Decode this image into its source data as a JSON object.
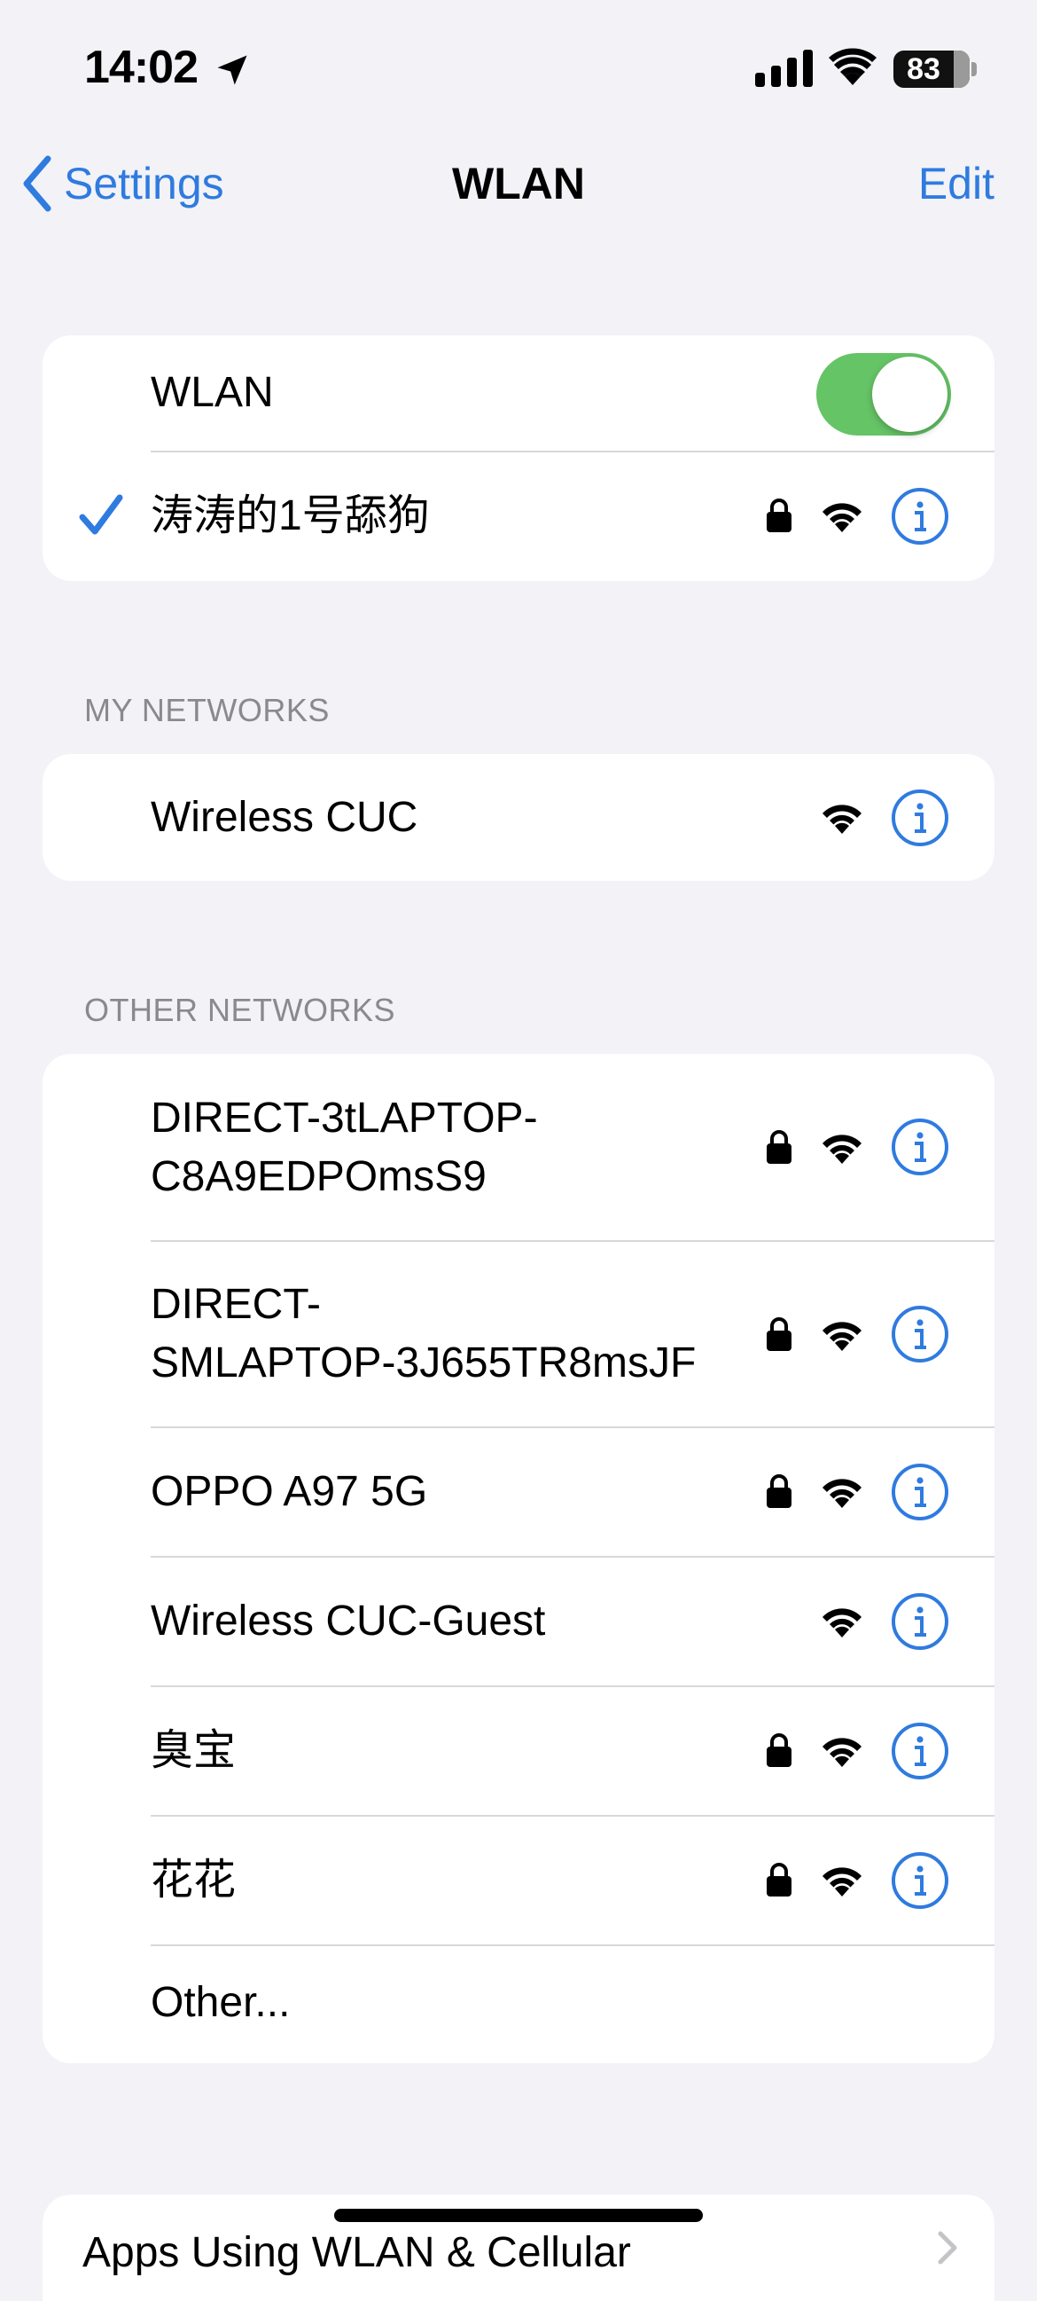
{
  "status_bar": {
    "time": "14:02",
    "battery": "83"
  },
  "nav": {
    "back_label": "Settings",
    "title": "WLAN",
    "edit_label": "Edit"
  },
  "wlan": {
    "label": "WLAN",
    "enabled": true,
    "connected_network": "涛涛的1号舔狗"
  },
  "sections": {
    "my_networks_header": "MY NETWORKS",
    "other_networks_header": "OTHER NETWORKS"
  },
  "my_networks": [
    {
      "name": "Wireless CUC",
      "locked": false
    }
  ],
  "other_networks": [
    {
      "name_line1": "DIRECT-3tLAPTOP-",
      "name_line2": "C8A9EDPOmsS9",
      "locked": true
    },
    {
      "name_line1": "DIRECT-",
      "name_line2": "SMLAPTOP-3J655TR8msJF",
      "locked": true
    },
    {
      "name": "OPPO A97 5G",
      "locked": true
    },
    {
      "name": "Wireless CUC-Guest",
      "locked": false
    },
    {
      "name": "臭宝",
      "locked": true
    },
    {
      "name": "花花",
      "locked": true
    }
  ],
  "other_label": "Other...",
  "bottom_row_label": "Apps Using WLAN & Cellular",
  "icons": [
    "location-arrow-icon",
    "cellular-signal-icon",
    "wifi-icon",
    "battery-icon",
    "back-chevron-icon",
    "checkmark-icon",
    "lock-icon",
    "info-icon"
  ],
  "colors": {
    "accent": "#2f7bdf",
    "toggle_on": "#65c466",
    "background": "#f2f2f7"
  }
}
